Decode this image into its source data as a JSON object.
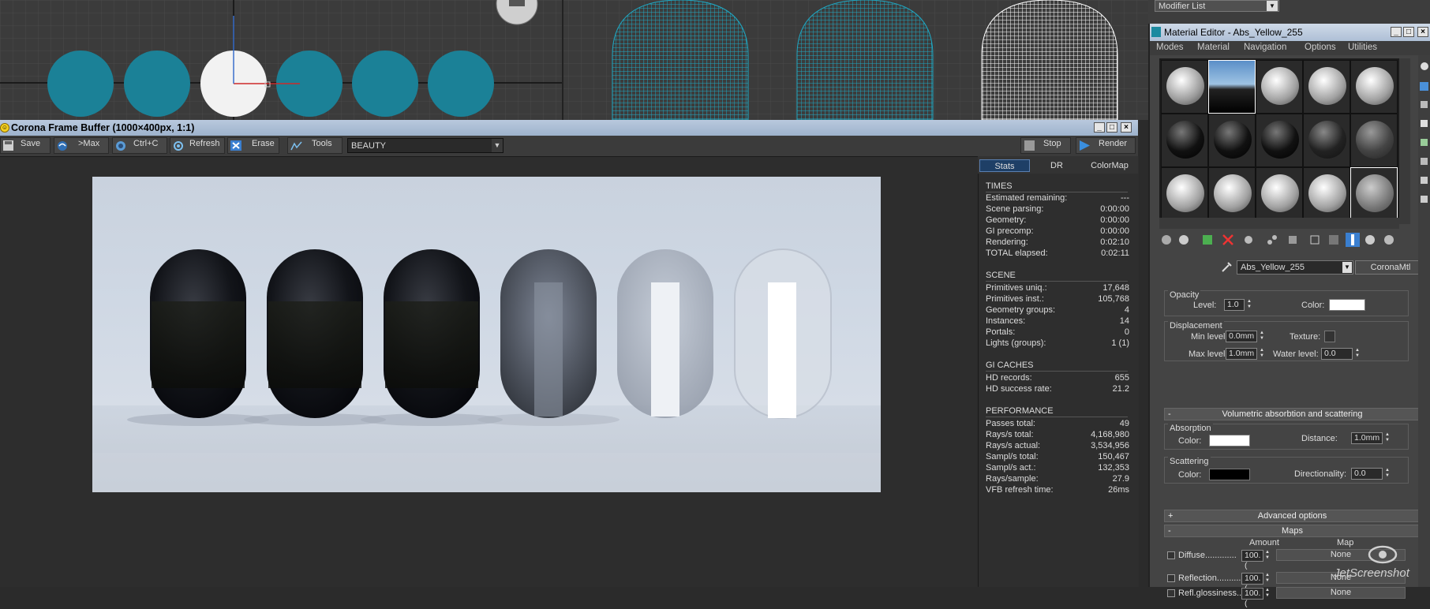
{
  "viewport": {
    "top_right": {
      "modifier_list": "Modifier List"
    }
  },
  "frame_buffer": {
    "title": "Corona Frame Buffer (1000×400px, 1:1)",
    "toolbar": {
      "save": "Save",
      "max": ">Max",
      "copy": "Ctrl+C",
      "refresh": "Refresh",
      "erase": "Erase",
      "tools": "Tools",
      "channel": "BEAUTY",
      "stop": "Stop",
      "render": "Render"
    },
    "stats_tabs": [
      "Stats",
      "DR",
      "ColorMap"
    ],
    "stats": {
      "times_title": "TIMES",
      "times": [
        {
          "k": "Estimated remaining:",
          "v": "---"
        },
        {
          "k": "Scene parsing:",
          "v": "0:00:00"
        },
        {
          "k": "Geometry:",
          "v": "0:00:00"
        },
        {
          "k": "GI precomp:",
          "v": "0:00:00"
        },
        {
          "k": "Rendering:",
          "v": "0:02:10"
        },
        {
          "k": "TOTAL elapsed:",
          "v": "0:02:11"
        }
      ],
      "scene_title": "SCENE",
      "scene": [
        {
          "k": "Primitives uniq.:",
          "v": "17,648"
        },
        {
          "k": "Primitives inst.:",
          "v": "105,768"
        },
        {
          "k": "Geometry groups:",
          "v": "4"
        },
        {
          "k": "Instances:",
          "v": "14"
        },
        {
          "k": "Portals:",
          "v": "0"
        },
        {
          "k": "Lights (groups):",
          "v": "1 (1)"
        }
      ],
      "gi_title": "GI CACHES",
      "gi": [
        {
          "k": "HD records:",
          "v": "655"
        },
        {
          "k": "HD success rate:",
          "v": "21.2"
        }
      ],
      "perf_title": "PERFORMANCE",
      "perf": [
        {
          "k": "Passes total:",
          "v": "49"
        },
        {
          "k": "Rays/s total:",
          "v": "4,168,980"
        },
        {
          "k": "Rays/s actual:",
          "v": "3,534,956"
        },
        {
          "k": "Sampl/s total:",
          "v": "150,467"
        },
        {
          "k": "Sampl/s act.:",
          "v": "132,353"
        },
        {
          "k": "Rays/sample:",
          "v": "27.9"
        },
        {
          "k": "VFB refresh time:",
          "v": "26ms"
        }
      ]
    }
  },
  "material_editor": {
    "title": "Material Editor - Abs_Yellow_255",
    "menu": [
      "Modes",
      "Material",
      "Navigation",
      "Options",
      "Utilities"
    ],
    "material_name": "Abs_Yellow_255",
    "material_type": "CoronaMtl",
    "opacity": {
      "title": "Opacity",
      "level_label": "Level:",
      "level": "1.0",
      "color_label": "Color:"
    },
    "displacement": {
      "title": "Displacement",
      "min_label": "Min level:",
      "min": "0.0mm",
      "texture_label": "Texture:",
      "max_label": "Max level:",
      "max": "1.0mm",
      "water_label": "Water level:",
      "water": "0.0"
    },
    "volumetric_rollout": "Volumetric absorbtion and scattering",
    "absorption": {
      "title": "Absorption",
      "color_label": "Color:",
      "distance_label": "Distance:",
      "distance": "1.0mm"
    },
    "scattering": {
      "title": "Scattering",
      "color_label": "Color:",
      "dir_label": "Directionality:",
      "dir": "0.0"
    },
    "advanced_rollout": "Advanced options",
    "maps_rollout": "Maps",
    "maps_headers": {
      "amount": "Amount",
      "map": "Map"
    },
    "maps": [
      {
        "label": "Diffuse.............",
        "amount": "100.(",
        "map": "None"
      },
      {
        "label": "Reflection...........",
        "amount": "100.(",
        "map": "None"
      },
      {
        "label": "Refl.glossiness...",
        "amount": "100.(",
        "map": "None"
      }
    ]
  },
  "watermark": "JetScreenshot"
}
